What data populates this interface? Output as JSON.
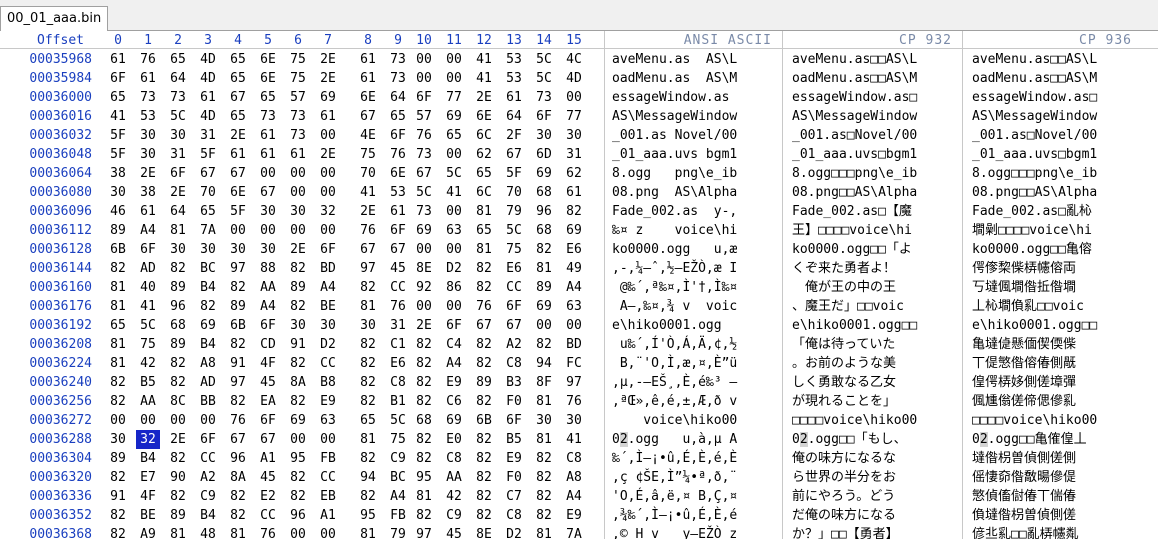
{
  "tab": {
    "label": "00_01_aaa.bin"
  },
  "header": {
    "offset": "Offset",
    "hex": [
      "0",
      "1",
      "2",
      "3",
      "4",
      "5",
      "6",
      "7",
      "8",
      "9",
      "10",
      "11",
      "12",
      "13",
      "14",
      "15"
    ],
    "panels": [
      "ANSI ASCII",
      "CP 932",
      "CP 936"
    ]
  },
  "rows": [
    {
      "offset": "00035968",
      "hex": [
        "61",
        "76",
        "65",
        "4D",
        "65",
        "6E",
        "75",
        "2E",
        "61",
        "73",
        "00",
        "00",
        "41",
        "53",
        "5C",
        "4C"
      ],
      "ansi": "aveMenu.as  AS\\L",
      "cp932": "aveMenu.as□□AS\\L",
      "cp936": "aveMenu.as□□AS\\L"
    },
    {
      "offset": "00035984",
      "hex": [
        "6F",
        "61",
        "64",
        "4D",
        "65",
        "6E",
        "75",
        "2E",
        "61",
        "73",
        "00",
        "00",
        "41",
        "53",
        "5C",
        "4D"
      ],
      "ansi": "oadMenu.as  AS\\M",
      "cp932": "oadMenu.as□□AS\\M",
      "cp936": "oadMenu.as□□AS\\M"
    },
    {
      "offset": "00036000",
      "hex": [
        "65",
        "73",
        "73",
        "61",
        "67",
        "65",
        "57",
        "69",
        "6E",
        "64",
        "6F",
        "77",
        "2E",
        "61",
        "73",
        "00"
      ],
      "ansi": "essageWindow.as ",
      "cp932": "essageWindow.as□",
      "cp936": "essageWindow.as□"
    },
    {
      "offset": "00036016",
      "hex": [
        "41",
        "53",
        "5C",
        "4D",
        "65",
        "73",
        "73",
        "61",
        "67",
        "65",
        "57",
        "69",
        "6E",
        "64",
        "6F",
        "77"
      ],
      "ansi": "AS\\MessageWindow",
      "cp932": "AS\\MessageWindow",
      "cp936": "AS\\MessageWindow"
    },
    {
      "offset": "00036032",
      "hex": [
        "5F",
        "30",
        "30",
        "31",
        "2E",
        "61",
        "73",
        "00",
        "4E",
        "6F",
        "76",
        "65",
        "6C",
        "2F",
        "30",
        "30"
      ],
      "ansi": "_001.as Novel/00",
      "cp932": "_001.as□Novel/00",
      "cp936": "_001.as□Novel/00"
    },
    {
      "offset": "00036048",
      "hex": [
        "5F",
        "30",
        "31",
        "5F",
        "61",
        "61",
        "61",
        "2E",
        "75",
        "76",
        "73",
        "00",
        "62",
        "67",
        "6D",
        "31"
      ],
      "ansi": "_01_aaa.uvs bgm1",
      "cp932": "_01_aaa.uvs□bgm1",
      "cp936": "_01_aaa.uvs□bgm1"
    },
    {
      "offset": "00036064",
      "hex": [
        "38",
        "2E",
        "6F",
        "67",
        "67",
        "00",
        "00",
        "00",
        "70",
        "6E",
        "67",
        "5C",
        "65",
        "5F",
        "69",
        "62"
      ],
      "ansi": "8.ogg   png\\e_ib",
      "cp932": "8.ogg□□□png\\e_ib",
      "cp936": "8.ogg□□□png\\e_ib"
    },
    {
      "offset": "00036080",
      "hex": [
        "30",
        "38",
        "2E",
        "70",
        "6E",
        "67",
        "00",
        "00",
        "41",
        "53",
        "5C",
        "41",
        "6C",
        "70",
        "68",
        "61"
      ],
      "ansi": "08.png  AS\\Alpha",
      "cp932": "08.png□□AS\\Alpha",
      "cp936": "08.png□□AS\\Alpha"
    },
    {
      "offset": "00036096",
      "hex": [
        "46",
        "61",
        "64",
        "65",
        "5F",
        "30",
        "30",
        "32",
        "2E",
        "61",
        "73",
        "00",
        "81",
        "79",
        "96",
        "82"
      ],
      "ansi": "Fade_002.as  y-,",
      "cp932": "Fade_002.as□【魔",
      "cp936": "Fade_002.as□亂杺"
    },
    {
      "offset": "00036112",
      "hex": [
        "89",
        "A4",
        "81",
        "7A",
        "00",
        "00",
        "00",
        "00",
        "76",
        "6F",
        "69",
        "63",
        "65",
        "5C",
        "68",
        "69"
      ],
      "ansi": "‰¤ z    voice\\hi",
      "cp932": "王】□□□□voice\\hi",
      "cp936": "墹劋□□□□voice\\hi"
    },
    {
      "offset": "00036128",
      "hex": [
        "6B",
        "6F",
        "30",
        "30",
        "30",
        "30",
        "2E",
        "6F",
        "67",
        "67",
        "00",
        "00",
        "81",
        "75",
        "82",
        "E6"
      ],
      "ansi": "ko0000.ogg   u,æ",
      "cp932": "ko0000.ogg□□「よ",
      "cp936": "ko0000.ogg□□亀傛"
    },
    {
      "offset": "00036144",
      "hex": [
        "82",
        "AD",
        "82",
        "BC",
        "97",
        "88",
        "82",
        "BD",
        "97",
        "45",
        "8E",
        "D2",
        "82",
        "E6",
        "81",
        "49"
      ],
      "ansi": ",-,¼—ˆ,½—EŽÒ,æ I",
      "cp932": "くぞ来た勇者よ！",
      "cp936": "偔偧棃偨梇幰傛両"
    },
    {
      "offset": "00036160",
      "hex": [
        "81",
        "40",
        "89",
        "B4",
        "82",
        "AA",
        "89",
        "A4",
        "82",
        "CC",
        "92",
        "86",
        "82",
        "CC",
        "89",
        "A4"
      ],
      "ansi": " @‰´,ª‰¤,Ì'†,Ì‰¤",
      "cp932": "　俺が王の中の王",
      "cp936": "丂墶偑墹偺拞偺墹"
    },
    {
      "offset": "00036176",
      "hex": [
        "81",
        "41",
        "96",
        "82",
        "89",
        "A4",
        "82",
        "BE",
        "81",
        "76",
        "00",
        "00",
        "76",
        "6F",
        "69",
        "63"
      ],
      "ansi": " A–,‰¤,¾ v  voic",
      "cp932": "、魔王だ」□□voic",
      "cp936": "丄杺墹偩乿□□voic"
    },
    {
      "offset": "00036192",
      "hex": [
        "65",
        "5C",
        "68",
        "69",
        "6B",
        "6F",
        "30",
        "30",
        "30",
        "31",
        "2E",
        "6F",
        "67",
        "67",
        "00",
        "00"
      ],
      "ansi": "e\\hiko0001.ogg  ",
      "cp932": "e\\hiko0001.ogg□□",
      "cp936": "e\\hiko0001.ogg□□"
    },
    {
      "offset": "00036208",
      "hex": [
        "81",
        "75",
        "89",
        "B4",
        "82",
        "CD",
        "91",
        "D2",
        "82",
        "C1",
        "82",
        "C4",
        "82",
        "A2",
        "82",
        "BD"
      ],
      "ansi": " u‰´,Í'Ò,Á,Ä,¢,½",
      "cp932": "「俺は待っていた",
      "cp936": "亀墶偼懸偭偰偄偨"
    },
    {
      "offset": "00036224",
      "hex": [
        "81",
        "42",
        "82",
        "A8",
        "91",
        "4F",
        "82",
        "CC",
        "82",
        "E6",
        "82",
        "A4",
        "82",
        "C8",
        "94",
        "FC"
      ],
      "ansi": " B,¨'O,Ì,æ,¤,È”ü",
      "cp932": "。お前のような美",
      "cp936": "丅偍慜偺傛偆側旤"
    },
    {
      "offset": "00036240",
      "hex": [
        "82",
        "B5",
        "82",
        "AD",
        "97",
        "45",
        "8A",
        "B8",
        "82",
        "C8",
        "82",
        "E9",
        "89",
        "B3",
        "8F",
        "97"
      ],
      "ansi": ",µ,-—EŠ¸,È,é‰³ —",
      "cp932": "しく勇敢なる乙女",
      "cp936": "偟偔梇姼側傞墇彈"
    },
    {
      "offset": "00036256",
      "hex": [
        "82",
        "AA",
        "8C",
        "BB",
        "82",
        "EA",
        "82",
        "E9",
        "82",
        "B1",
        "82",
        "C6",
        "82",
        "F0",
        "81",
        "76"
      ],
      "ansi": ",ªŒ»,ê,é,±,Æ,ð v",
      "cp932": "が現れることを」",
      "cp936": "偑尰傟傞偙偲傪乿"
    },
    {
      "offset": "00036272",
      "hex": [
        "00",
        "00",
        "00",
        "00",
        "76",
        "6F",
        "69",
        "63",
        "65",
        "5C",
        "68",
        "69",
        "6B",
        "6F",
        "30",
        "30"
      ],
      "ansi": "    voice\\hiko00",
      "cp932": "□□□□voice\\hiko00",
      "cp936": "□□□□voice\\hiko00"
    },
    {
      "offset": "00036288",
      "hex": [
        "30",
        "32",
        "2E",
        "6F",
        "67",
        "67",
        "00",
        "00",
        "81",
        "75",
        "82",
        "E0",
        "82",
        "B5",
        "81",
        "41"
      ],
      "ansi": "02.ogg   u,à,µ A",
      "cp932": "02.ogg□□「もし、",
      "cp936": "02.ogg□□亀傕偟丄"
    },
    {
      "offset": "00036304",
      "hex": [
        "89",
        "B4",
        "82",
        "CC",
        "96",
        "A1",
        "95",
        "FB",
        "82",
        "C9",
        "82",
        "C8",
        "82",
        "E9",
        "82",
        "C8"
      ],
      "ansi": "‰´,Ì–¡•û,É,È,é,È",
      "cp932": "俺の味方になるな",
      "cp936": "墶偺枴曽偵側傞側"
    },
    {
      "offset": "00036320",
      "hex": [
        "82",
        "E7",
        "90",
        "A2",
        "8A",
        "45",
        "82",
        "CC",
        "94",
        "BC",
        "95",
        "AA",
        "82",
        "F0",
        "82",
        "A8"
      ],
      "ansi": ",ç ¢ŠE,Ì”¼•ª,ð,¨",
      "cp932": "ら世界の半分をお",
      "cp936": "傜悽奅偺敿暘傪偍"
    },
    {
      "offset": "00036336",
      "hex": [
        "91",
        "4F",
        "82",
        "C9",
        "82",
        "E2",
        "82",
        "EB",
        "82",
        "A4",
        "81",
        "42",
        "82",
        "C7",
        "82",
        "A4"
      ],
      "ansi": "'O,É,â,ë,¤ B,Ç,¤",
      "cp932": "前にやろう。どう",
      "cp936": "慜偵傗傠偆丅偳偆"
    },
    {
      "offset": "00036352",
      "hex": [
        "82",
        "BE",
        "89",
        "B4",
        "82",
        "CC",
        "96",
        "A1",
        "95",
        "FB",
        "82",
        "C9",
        "82",
        "C8",
        "82",
        "E9"
      ],
      "ansi": ",¾‰´,Ì–¡•û,É,È,é",
      "cp932": "だ俺の味方になる",
      "cp936": "偩墶偺枴曽偵側傞"
    },
    {
      "offset": "00036368",
      "hex": [
        "82",
        "A9",
        "81",
        "48",
        "81",
        "76",
        "00",
        "00",
        "81",
        "79",
        "97",
        "45",
        "8E",
        "D2",
        "81",
        "7A"
      ],
      "ansi": ",© H v   y—EŽÒ z",
      "cp932": "か？」□□【勇者】",
      "cp936": "偐丠乿□□亂梇幰亃"
    }
  ]
}
